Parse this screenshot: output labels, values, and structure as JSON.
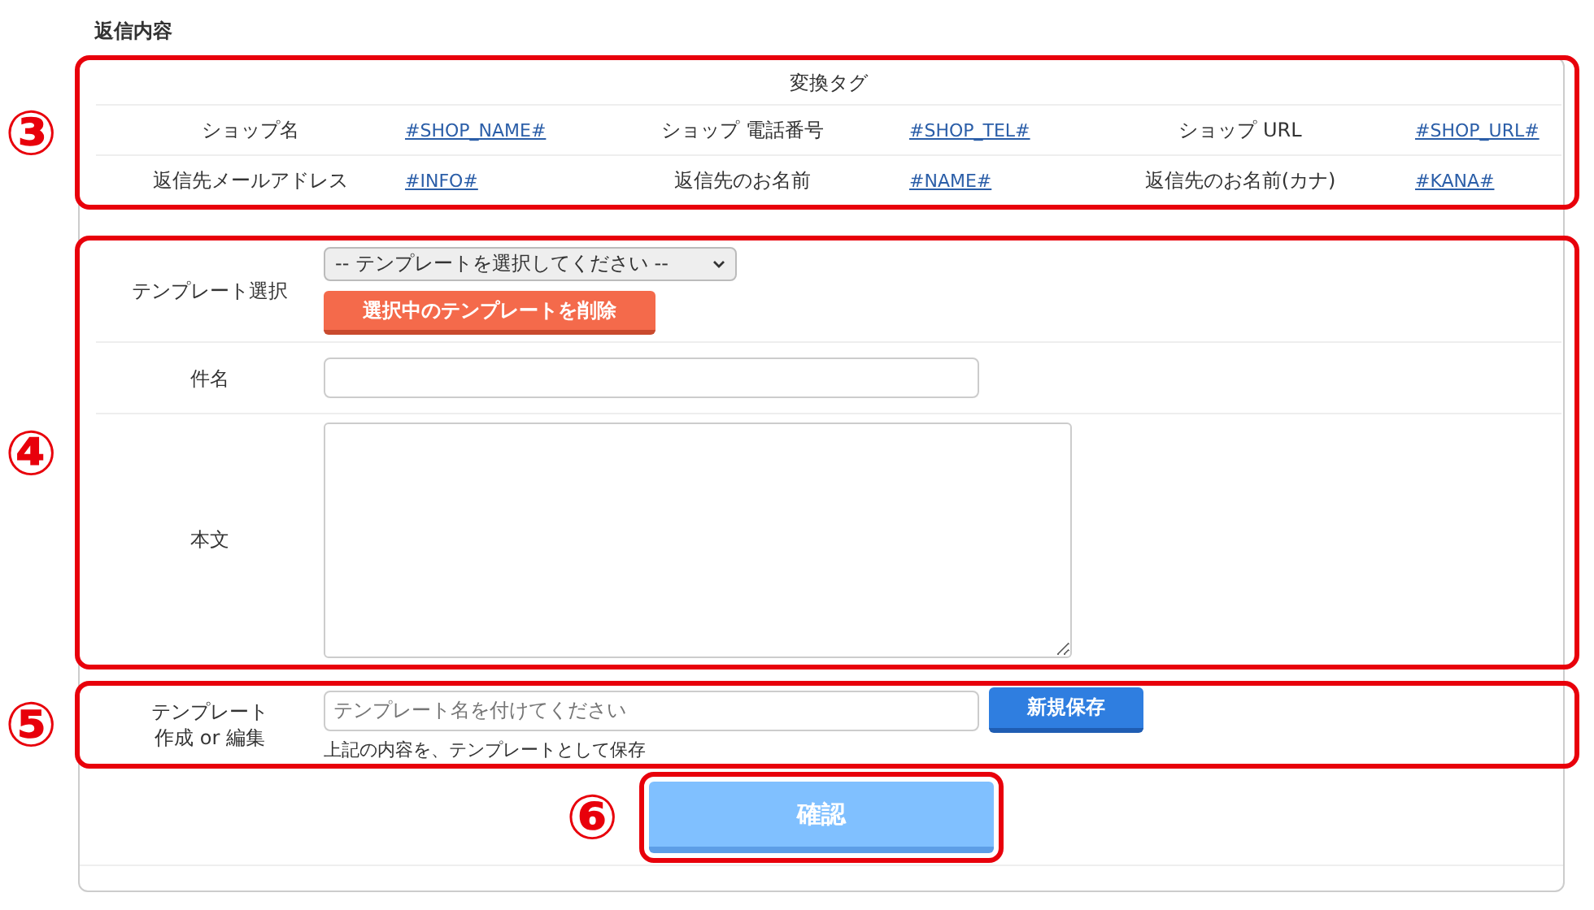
{
  "heading": "返信内容",
  "tag_table": {
    "marker": "③",
    "title": "変換タグ",
    "rows": [
      [
        {
          "label": "ショップ名",
          "tag": "#SHOP_NAME#"
        },
        {
          "label": "ショップ 電話番号",
          "tag": "#SHOP_TEL#"
        },
        {
          "label": "ショップ URL",
          "tag": "#SHOP_URL#"
        }
      ],
      [
        {
          "label": "返信先メールアドレス",
          "tag": "#INFO#"
        },
        {
          "label": "返信先のお名前",
          "tag": "#NAME#"
        },
        {
          "label": "返信先のお名前(カナ)",
          "tag": "#KANA#"
        }
      ]
    ]
  },
  "template_form": {
    "marker": "④",
    "rows": [
      {
        "kind": "select",
        "label": "テンプレート選択",
        "value": "-- テンプレートを選択してください --",
        "button": "選択中のテンプレートを削除"
      },
      {
        "kind": "input",
        "label": "件名"
      },
      {
        "kind": "textarea",
        "label": "本文"
      }
    ]
  },
  "save_section": {
    "marker": "⑤",
    "label_lines": [
      "テンプレート",
      "作成 or 編集"
    ],
    "placeholder": "テンプレート名を付けてください",
    "button": "新規保存",
    "note": "上記の内容を、テンプレートとして保存"
  },
  "confirm": {
    "marker": "⑥",
    "button": "確認"
  }
}
